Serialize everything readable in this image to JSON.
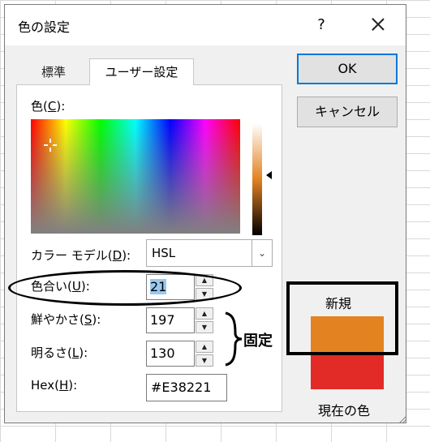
{
  "dialog": {
    "title": "色の設定",
    "help": "?",
    "tabs": {
      "standard": "標準",
      "custom": "ユーザー設定"
    },
    "buttons": {
      "ok": "OK",
      "cancel": "キャンセル"
    }
  },
  "color_section": {
    "label_prefix": "色(",
    "label_key": "C",
    "label_suffix": "):"
  },
  "color_model": {
    "label_prefix": "カラー モデル(",
    "label_key": "D",
    "label_suffix": "):",
    "selected": "HSL"
  },
  "fields": {
    "hue": {
      "prefix": "色合い(",
      "key": "U",
      "suffix": "):",
      "value": "21"
    },
    "saturation": {
      "prefix": "鮮やかさ(",
      "key": "S",
      "suffix": "):",
      "value": "197"
    },
    "lightness": {
      "prefix": "明るさ(",
      "key": "L",
      "suffix": "):",
      "value": "130"
    },
    "hex": {
      "prefix": "Hex(",
      "key": "H",
      "suffix": "):",
      "value": "#E38221"
    }
  },
  "preview": {
    "new_label": "新規",
    "current_label": "現在の色",
    "new_color": "#E38221",
    "current_color": "#E22B26"
  },
  "annotation": {
    "fixed_label": "固定"
  }
}
